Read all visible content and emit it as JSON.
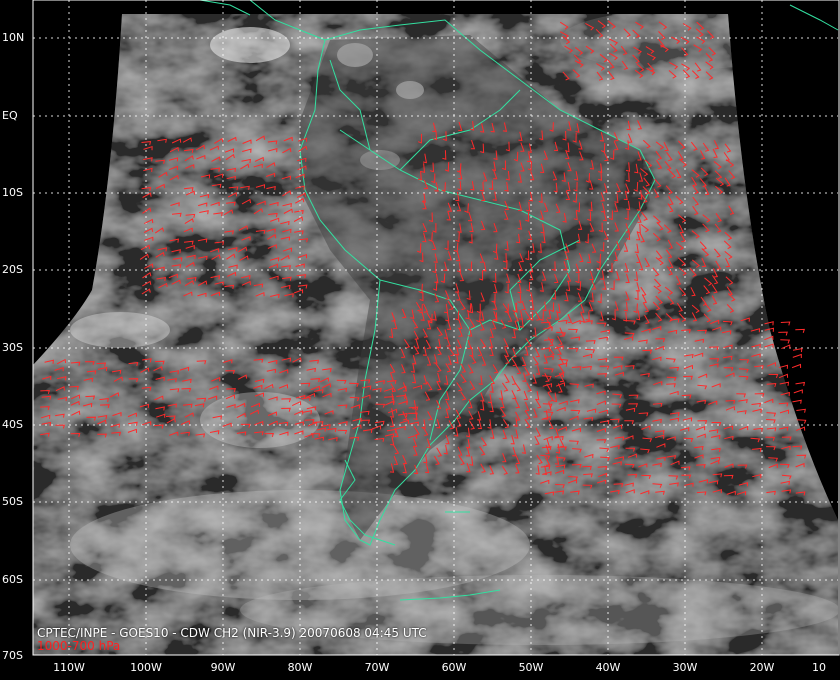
{
  "map": {
    "caption": "CPTEC/INPE - GOES10 - CDW CH2 (NIR-3.9) 20070608 04:45 UTC",
    "level": "1000-700 hPa",
    "lat_labels": [
      "10N",
      "EQ",
      "10S",
      "20S",
      "30S",
      "40S",
      "50S",
      "60S",
      "70S"
    ],
    "lon_labels": [
      "110W",
      "100W",
      "90W",
      "80W",
      "70W",
      "60W",
      "50W",
      "40W",
      "30W",
      "20W",
      "10"
    ],
    "colors": {
      "background": "#000000",
      "wind_barbs": "#ff2a2a",
      "coastlines": "#33e0a0",
      "grid": "#ffffff",
      "caption": "#ffffff",
      "level_text": "#ff2020"
    }
  }
}
